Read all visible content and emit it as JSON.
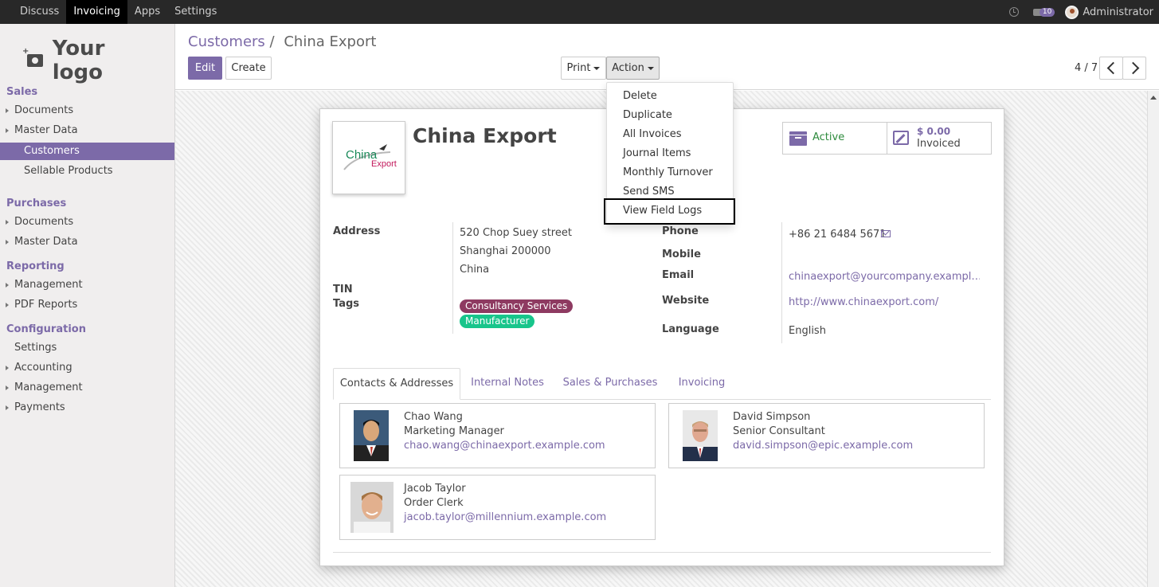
{
  "topbar": {
    "menu": [
      "Discuss",
      "Invoicing",
      "Apps",
      "Settings"
    ],
    "active_menu": "Invoicing",
    "chat_badge": "10",
    "user": "Administrator"
  },
  "sidebar": {
    "logo_text": "Your logo",
    "sections": [
      {
        "title": "Sales",
        "items": [
          "Documents",
          "Master Data",
          "Customers",
          "Sellable Products"
        ]
      },
      {
        "title": "Purchases",
        "items": [
          "Documents",
          "Master Data"
        ]
      },
      {
        "title": "Reporting",
        "items": [
          "Management",
          "PDF Reports"
        ]
      },
      {
        "title": "Configuration",
        "items": [
          "Settings",
          "Accounting",
          "Management",
          "Payments"
        ]
      }
    ]
  },
  "breadcrumb": {
    "parent": "Customers",
    "separator": "/",
    "current": "China Export"
  },
  "buttons": {
    "edit": "Edit",
    "create": "Create",
    "print": "Print",
    "action": "Action"
  },
  "pager": "4 / 7",
  "dropdown": {
    "items": [
      "Delete",
      "Duplicate",
      "All Invoices",
      "Journal Items",
      "Monthly Turnover",
      "Send SMS",
      "View Field Logs"
    ],
    "highlighted": "View Field Logs"
  },
  "partner": {
    "name": "China Export",
    "logo_text_1": "China",
    "logo_text_2": "Export",
    "stat_active": "Active",
    "stat_invoiced_amount": "$ 0.00",
    "stat_invoiced_label": "Invoiced",
    "labels": {
      "address": "Address",
      "tin": "TIN",
      "tags": "Tags",
      "phone": "Phone",
      "mobile": "Mobile",
      "email": "Email",
      "website": "Website",
      "language": "Language"
    },
    "address_lines": [
      "520 Chop Suey street",
      "Shanghai 200000",
      "China"
    ],
    "tags": [
      {
        "name": "Consultancy Services",
        "color": "#8e3a61"
      },
      {
        "name": "Manufacturer",
        "color": "#18c58b"
      }
    ],
    "phone": "+86 21 6484 5671",
    "email": "chinaexport@yourcompany.exampl…",
    "website": "http://www.chinaexport.com/",
    "language": "English"
  },
  "tabs": [
    "Contacts & Addresses",
    "Internal Notes",
    "Sales & Purchases",
    "Invoicing"
  ],
  "contacts": [
    {
      "name": "Chao Wang",
      "title": "Marketing Manager",
      "email": "chao.wang@chinaexport.example.com"
    },
    {
      "name": "David Simpson",
      "title": "Senior Consultant",
      "email": "david.simpson@epic.example.com"
    },
    {
      "name": "Jacob Taylor",
      "title": "Order Clerk",
      "email": "jacob.taylor@millennium.example.com"
    }
  ],
  "colors": {
    "accent": "#7c6aa8",
    "navbar": "#282828",
    "sidebar": "#f0eeee"
  }
}
